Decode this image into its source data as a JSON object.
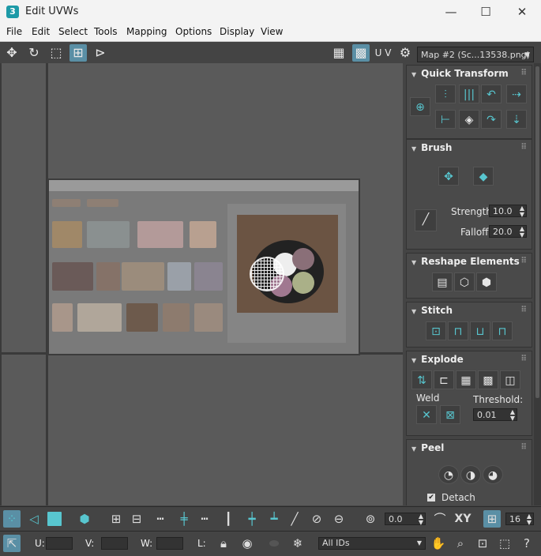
{
  "window": {
    "title": "Edit UVWs",
    "app_icon": "3"
  },
  "menu": [
    "File",
    "Edit",
    "Select",
    "Tools",
    "Mapping",
    "Options",
    "Display",
    "View"
  ],
  "toolbar": {
    "uv_label": "U V",
    "map_dropdown": "Map #2 (Sc...13538.png)"
  },
  "panel": {
    "quick_transform": {
      "title": "Quick Transform"
    },
    "brush": {
      "title": "Brush",
      "strength_label": "Strength:",
      "strength_value": "10.0",
      "falloff_label": "Falloff:",
      "falloff_value": "20.0"
    },
    "reshape": {
      "title": "Reshape Elements"
    },
    "stitch": {
      "title": "Stitch"
    },
    "explode": {
      "title": "Explode",
      "weld_label": "Weld",
      "threshold_label": "Threshold:",
      "threshold_value": "0.01"
    },
    "peel": {
      "title": "Peel",
      "detach_label": "Detach"
    }
  },
  "bottom": {
    "angle_value": "0.0",
    "xy_label": "XY",
    "grid_value": "16",
    "u_label": "U:",
    "v_label": "V:",
    "w_label": "W:",
    "l_label": "L:",
    "ids_dropdown": "All IDs"
  }
}
